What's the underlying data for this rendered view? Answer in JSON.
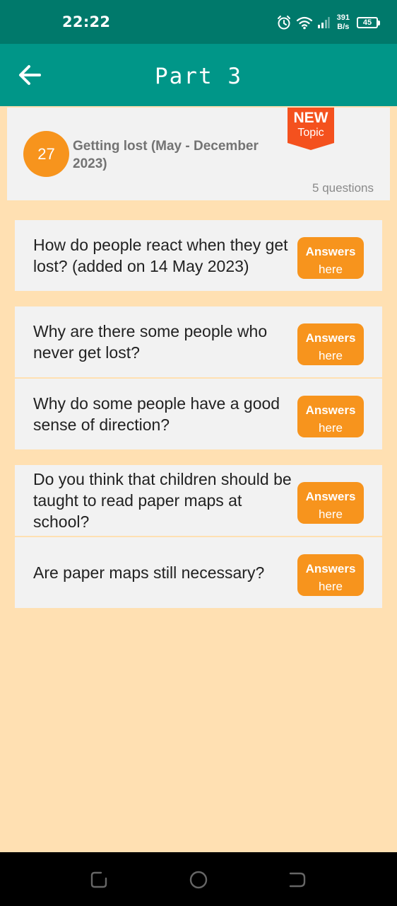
{
  "status_bar": {
    "time": "22:22",
    "net_speed_value": "391",
    "net_speed_unit": "B/s",
    "battery": "45"
  },
  "app_bar": {
    "title": "Part 3"
  },
  "topic": {
    "number": "27",
    "title": "Getting lost (May - December 2023)",
    "question_count": "5 questions",
    "badge_new": "NEW",
    "badge_topic": "Topic"
  },
  "questions": [
    {
      "text": "How do people react when they get lost? (added on 14 May 2023)",
      "button_top": "Answers",
      "button_bottom": "here"
    },
    {
      "text": "Why are there some people who never get lost?",
      "button_top": "Answers",
      "button_bottom": "here"
    },
    {
      "text": "Why do some people have a good sense of direction?",
      "button_top": "Answers",
      "button_bottom": "here"
    },
    {
      "text": "Do you think that children should be taught to read paper maps at school?",
      "button_top": "Answers",
      "button_bottom": "here"
    },
    {
      "text": "Are paper maps still necessary?",
      "button_top": "Answers",
      "button_bottom": "here"
    }
  ],
  "colors": {
    "status_bar": "#00796B",
    "app_bar": "#009688",
    "background": "#FFE0B2",
    "accent_orange": "#F7941D",
    "badge_red": "#F4511E",
    "card": "#F2F2F2"
  },
  "icons": [
    "alarm-icon",
    "wifi-icon",
    "signal-icon",
    "battery-icon",
    "back-arrow-icon",
    "recents-icon",
    "home-icon",
    "back-nav-icon"
  ]
}
